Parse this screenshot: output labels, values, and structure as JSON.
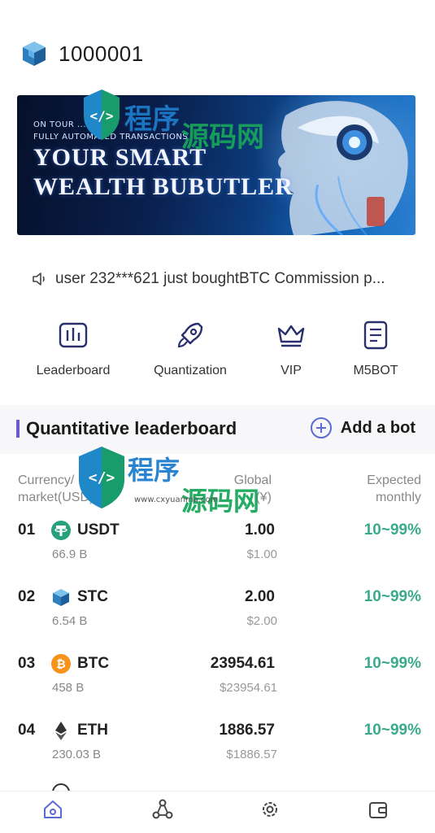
{
  "header": {
    "uid": "1000001",
    "logo_icon": "cube-icon"
  },
  "banner": {
    "line1": "ON  TOUR  ...",
    "line2": "FULLY AUTOMATED TRANSACTIONS",
    "headline1": "YOUR SMART",
    "headline2": "WEALTH BUBUTLER"
  },
  "notice": {
    "icon": "speaker-icon",
    "text": "user 232***621 just boughtBTC Commission p..."
  },
  "menu": [
    {
      "label": "Leaderboard",
      "icon": "bar-chart-icon"
    },
    {
      "label": "Quantization",
      "icon": "rocket-icon"
    },
    {
      "label": "VIP",
      "icon": "crown-icon"
    },
    {
      "label": "M5BOT",
      "icon": "document-icon"
    }
  ],
  "leaderboard": {
    "title": "Quantitative leaderboard",
    "add_label": "Add a bot",
    "columns": {
      "currency_line1": "Currency/ ...",
      "currency_line2": "market(USD)",
      "global_line1": "Global",
      "global_line2": "(¥)",
      "expected_line1": "Expected",
      "expected_line2": "monthly"
    },
    "rows": [
      {
        "index": "01",
        "symbol": "USDT",
        "volume": "66.9 B",
        "price": "1.00",
        "price_cny": "$1.00",
        "expected": "10~99%",
        "icon": "tether-icon",
        "color": "#26a17b"
      },
      {
        "index": "02",
        "symbol": "STC",
        "volume": "6.54 B",
        "price": "2.00",
        "price_cny": "$2.00",
        "expected": "10~99%",
        "icon": "cube-icon",
        "color": "#3b8fd9"
      },
      {
        "index": "03",
        "symbol": "BTC",
        "volume": "458 B",
        "price": "23954.61",
        "price_cny": "$23954.61",
        "expected": "10~99%",
        "icon": "bitcoin-icon",
        "color": "#f7931a"
      },
      {
        "index": "04",
        "symbol": "ETH",
        "volume": "230.03 B",
        "price": "1886.57",
        "price_cny": "$1886.57",
        "expected": "10~99%",
        "icon": "ethereum-icon",
        "color": "#333333"
      }
    ]
  },
  "tabbar": [
    {
      "icon": "home-icon",
      "active": true
    },
    {
      "icon": "nodes-icon",
      "active": false
    },
    {
      "icon": "gear-icon",
      "active": false
    },
    {
      "icon": "wallet-icon",
      "active": false
    }
  ],
  "watermark": {
    "text": "程序源码网",
    "url": "www.cxyuanma.com"
  },
  "colors": {
    "accent": "#6a5acd",
    "positive": "#3aab8a"
  }
}
